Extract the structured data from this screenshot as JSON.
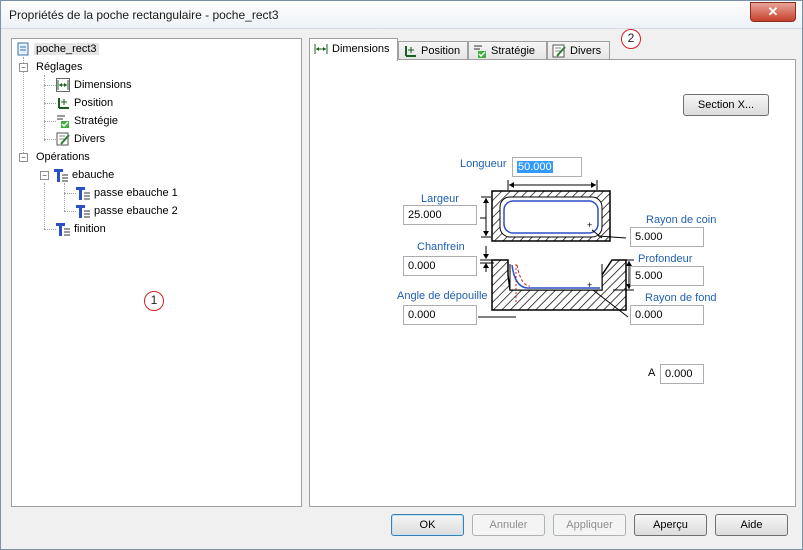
{
  "window": {
    "title": "Propriétés de la poche rectangulaire - poche_rect3",
    "close_label": "✕"
  },
  "tree": {
    "root": "poche_rect3",
    "reglages": "Réglages",
    "dimensions": "Dimensions",
    "position": "Position",
    "strategie": "Stratégie",
    "divers": "Divers",
    "operations": "Opérations",
    "ebauche": "ebauche",
    "passe1": "passe ebauche 1",
    "passe2": "passe ebauche 2",
    "finition": "finition"
  },
  "markers": {
    "one": "1",
    "two": "2"
  },
  "tabs": {
    "dimensions": "Dimensions",
    "position": "Position",
    "strategie": "Stratégie",
    "divers": "Divers"
  },
  "params": {
    "section_button": "Section X...",
    "longueur_label": "Longueur",
    "longueur_value": "50.000",
    "largeur_label": "Largeur",
    "largeur_value": "25.000",
    "rayon_coin_label": "Rayon de coin",
    "rayon_coin_value": "5.000",
    "chanfrein_label": "Chanfrein",
    "chanfrein_value": "0.000",
    "profondeur_label": "Profondeur",
    "profondeur_value": "5.000",
    "angle_label": "Angle de dépouille",
    "angle_value": "0.000",
    "rayon_fond_label": "Rayon de fond",
    "rayon_fond_value": "0.000",
    "a_label": "A",
    "a_value": "0.000"
  },
  "buttons": {
    "ok": "OK",
    "annuler": "Annuler",
    "appliquer": "Appliquer",
    "apercu": "Aperçu",
    "aide": "Aide"
  },
  "colors": {
    "accent": "#1f5fb0",
    "marker": "#d02020",
    "selection": "#3399ff"
  }
}
